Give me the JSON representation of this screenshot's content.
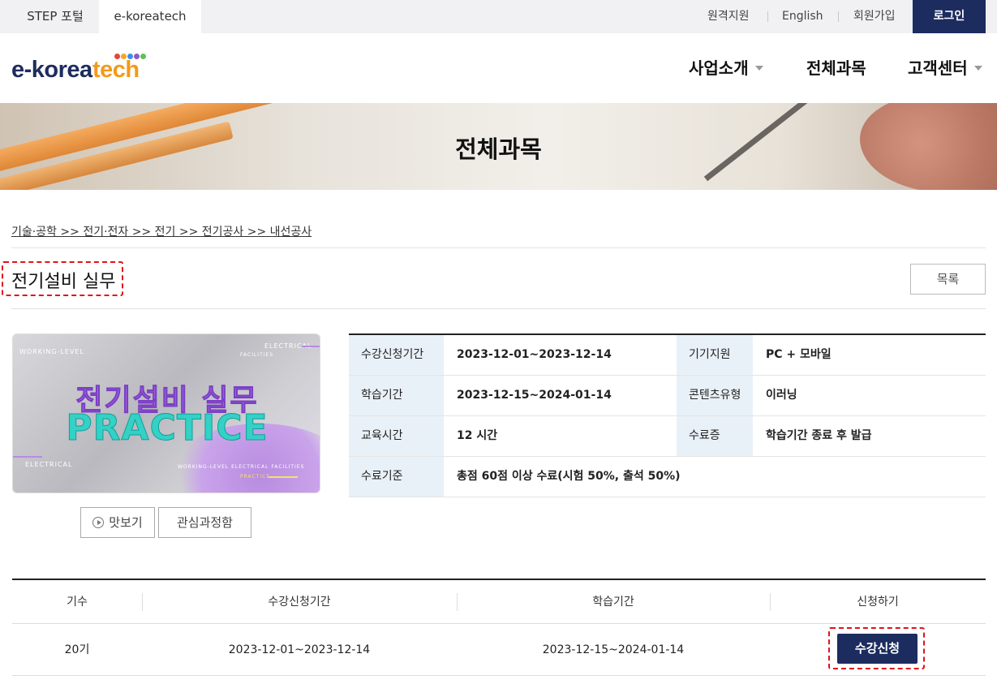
{
  "topbar": {
    "tabs": [
      "STEP 포털",
      "e-koreatech"
    ],
    "utility_links": [
      "원격지원",
      "English",
      "회원가입"
    ],
    "login_label": "로그인"
  },
  "header": {
    "logo_text_primary": "e-korea",
    "logo_text_accent": "tech",
    "logo_dot_colors": [
      "#e9433b",
      "#f5a623",
      "#3b8ee9",
      "#8f57c9",
      "#5fbf5a"
    ],
    "nav": [
      "사업소개",
      "전체과목",
      "고객센터"
    ]
  },
  "banner": {
    "title": "전체과목"
  },
  "breadcrumb": "기술·공학 >> 전기·전자 >> 전기 >> 전기공사 >> 내선공사",
  "course": {
    "title": "전기설비 실무",
    "list_button": "목록",
    "thumbnail": {
      "title_korean": "전기설비 실무",
      "title_english": "PRACTICE",
      "tag_left_top": "WORKING-LEVEL",
      "tag_right_top": "ELECTRICAL",
      "tag_right_small": "FACILITIES",
      "tag_left_bottom": "ELECTRICAL",
      "tag_bottom": "WORKING-LEVEL ELECTRICAL FACILITIES",
      "tag_bottom_small": "PRACTICE"
    },
    "preview_button": "맛보기",
    "wishlist_button": "관심과정함"
  },
  "info": {
    "rows": [
      [
        {
          "label": "수강신청기간",
          "value": "2023-12-01~2023-12-14"
        },
        {
          "label": "기기지원",
          "value": "PC + 모바일"
        }
      ],
      [
        {
          "label": "학습기간",
          "value": "2023-12-15~2024-01-14"
        },
        {
          "label": "콘텐츠유형",
          "value": "이러닝"
        }
      ],
      [
        {
          "label": "교육시간",
          "value": "12 시간"
        },
        {
          "label": "수료증",
          "value": "학습기간 종료 후 발급"
        }
      ],
      [
        {
          "label": "수료기준",
          "value": "총점 60점 이상 수료(시험 50%, 출석 50%)"
        }
      ]
    ]
  },
  "schedule": {
    "headers": [
      "기수",
      "수강신청기간",
      "학습기간",
      "신청하기"
    ],
    "rows": [
      {
        "term": "20기",
        "apply_period": "2023-12-01~2023-12-14",
        "study_period": "2023-12-15~2024-01-14",
        "action": "수강신청"
      }
    ]
  },
  "colors": {
    "navy": "#1d2c5f",
    "accent_orange": "#f39a1a",
    "highlight_red": "#e0121b",
    "table_header_bg": "#e9f1f8"
  }
}
